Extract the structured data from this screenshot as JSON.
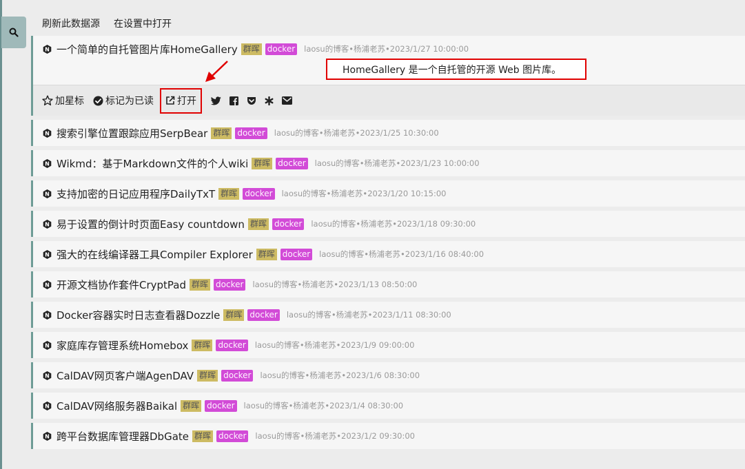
{
  "toolbar": {
    "refresh_label": "刷新此数据源",
    "open_settings_label": "在设置中打开"
  },
  "expanded": {
    "title": "一个简单的自托管图片库HomeGallery",
    "tag_q": "群晖",
    "tag_d": "docker",
    "meta": "laosu的博客•杨浦老苏•2023/1/27 10:00:00",
    "description": "HomeGallery 是一个自托管的开源 Web 图片库。",
    "actions": {
      "star_label": "加星标",
      "mark_read_label": "标记为已读",
      "open_label": "打开"
    }
  },
  "items": [
    {
      "title": "搜索引擎位置跟踪应用SerpBear",
      "tag_q": "群晖",
      "tag_d": "docker",
      "meta": "laosu的博客•杨浦老苏•2023/1/25 10:30:00"
    },
    {
      "title": "Wikmd：基于Markdown文件的个人wiki",
      "tag_q": "群晖",
      "tag_d": "docker",
      "meta": "laosu的博客•杨浦老苏•2023/1/23 10:00:00"
    },
    {
      "title": "支持加密的日记应用程序DailyTxT",
      "tag_q": "群晖",
      "tag_d": "docker",
      "meta": "laosu的博客•杨浦老苏•2023/1/20 10:15:00"
    },
    {
      "title": "易于设置的倒计时页面Easy countdown",
      "tag_q": "群晖",
      "tag_d": "docker",
      "meta": "laosu的博客•杨浦老苏•2023/1/18 09:30:00"
    },
    {
      "title": "强大的在线编译器工具Compiler Explorer",
      "tag_q": "群晖",
      "tag_d": "docker",
      "meta": "laosu的博客•杨浦老苏•2023/1/16 08:40:00"
    },
    {
      "title": "开源文档协作套件CryptPad",
      "tag_q": "群晖",
      "tag_d": "docker",
      "meta": "laosu的博客•杨浦老苏•2023/1/13 08:50:00"
    },
    {
      "title": "Docker容器实时日志查看器Dozzle",
      "tag_q": "群晖",
      "tag_d": "docker",
      "meta": "laosu的博客•杨浦老苏•2023/1/11 08:30:00"
    },
    {
      "title": "家庭库存管理系统Homebox",
      "tag_q": "群晖",
      "tag_d": "docker",
      "meta": "laosu的博客•杨浦老苏•2023/1/9 09:00:00"
    },
    {
      "title": "CalDAV网页客户端AgenDAV",
      "tag_q": "群晖",
      "tag_d": "docker",
      "meta": "laosu的博客•杨浦老苏•2023/1/6 08:30:00"
    },
    {
      "title": "CalDAV网络服务器Baikal",
      "tag_q": "群晖",
      "tag_d": "docker",
      "meta": "laosu的博客•杨浦老苏•2023/1/4 08:30:00"
    },
    {
      "title": "跨平台数据库管理器DbGate",
      "tag_q": "群晖",
      "tag_d": "docker",
      "meta": "laosu的博客•杨浦老苏•2023/1/2 09:30:00"
    }
  ]
}
